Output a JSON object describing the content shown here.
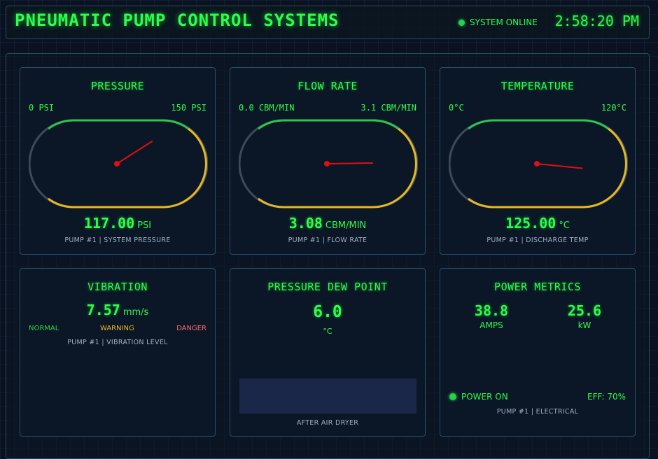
{
  "header": {
    "title": "PNEUMATIC PUMP CONTROL SYSTEMS",
    "status_text": "SYSTEM ONLINE",
    "clock": "2:58:20 PM"
  },
  "colors": {
    "accent": "#2bff4a",
    "warning": "#e6b820",
    "danger": "#ff6b6b",
    "needle": "#e01010"
  },
  "gauges": [
    {
      "title": "PRESSURE",
      "range_min": "0 PSI",
      "range_max": "150 PSI",
      "value": "117.00",
      "value_num": 117,
      "min": 0,
      "max": 150,
      "unit": "PSI",
      "caption": "PUMP #1 | SYSTEM PRESSURE"
    },
    {
      "title": "FLOW RATE",
      "range_min": "0.0 CBM/MIN",
      "range_max": "3.1 CBM/MIN",
      "value": "3.08",
      "value_num": 3.08,
      "min": 0,
      "max": 3.1,
      "unit": "CBM/MIN",
      "caption": "PUMP #1 | FLOW RATE"
    },
    {
      "title": "TEMPERATURE",
      "range_min": "0°C",
      "range_max": "120°C",
      "value": "125.00",
      "value_num": 125,
      "min": 0,
      "max": 120,
      "unit": "°C",
      "caption": "PUMP #1 | DISCHARGE TEMP"
    }
  ],
  "vibration": {
    "title": "VIBRATION",
    "value": "7.57",
    "unit": "mm/s",
    "levels": {
      "normal": "NORMAL",
      "warning": "WARNING",
      "danger": "DANGER"
    },
    "caption": "PUMP #1 | VIBRATION LEVEL"
  },
  "dew_point": {
    "title": "PRESSURE DEW POINT",
    "value": "6.0",
    "unit": "°C",
    "caption": "AFTER AIR DRYER"
  },
  "power": {
    "title": "POWER METRICS",
    "amps_value": "38.8",
    "amps_label": "AMPS",
    "kw_value": "25.6",
    "kw_label": "kW",
    "status": "POWER ON",
    "efficiency": "EFF: 70%",
    "caption": "PUMP #1 | ELECTRICAL"
  }
}
